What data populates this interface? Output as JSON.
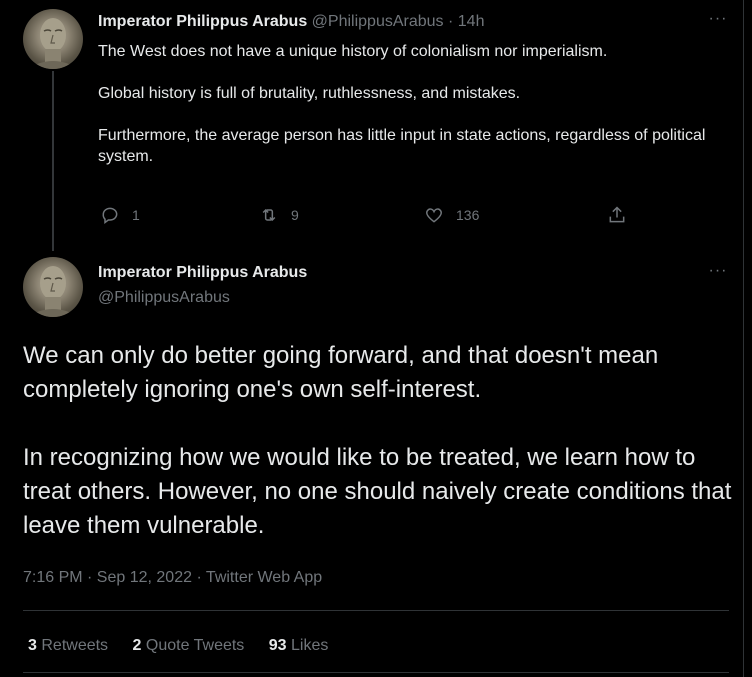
{
  "parent_tweet": {
    "name": "Imperator Philippus Arabus",
    "handle": "@PhilippusArabus",
    "separator": "·",
    "time": "14h",
    "more_icon": "···",
    "paragraphs": [
      "The West does not have a unique history of colonialism nor imperialism.",
      "Global history is full of brutality, ruthlessness, and mistakes.",
      "Furthermore, the average person has little input in state actions, regardless of political system."
    ],
    "replies": "1",
    "retweets": "9",
    "likes": "136"
  },
  "main_tweet": {
    "name": "Imperator Philippus Arabus",
    "handle": "@PhilippusArabus",
    "more_icon": "···",
    "paragraphs": [
      "We can only do better going forward, and that doesn't mean completely ignoring one's own self-interest.",
      "In recognizing how we would like to be treated, we learn how to treat others. However, no one should naively create conditions that leave them vulnerable."
    ],
    "meta": "7:16 PM · Sep 12, 2022 · Twitter Web App",
    "stats": {
      "retweets_count": "3",
      "retweets_label": "Retweets",
      "quotes_count": "2",
      "quotes_label": "Quote Tweets",
      "likes_count": "93",
      "likes_label": "Likes"
    }
  },
  "icons": {
    "reply": "reply-icon",
    "retweet": "retweet-icon",
    "like": "heart-icon",
    "share": "share-icon",
    "more": "more-icon"
  },
  "colors": {
    "background": "#000000",
    "text": "#e7e9ea",
    "secondary_text": "#71767b",
    "border": "#2f3336"
  }
}
